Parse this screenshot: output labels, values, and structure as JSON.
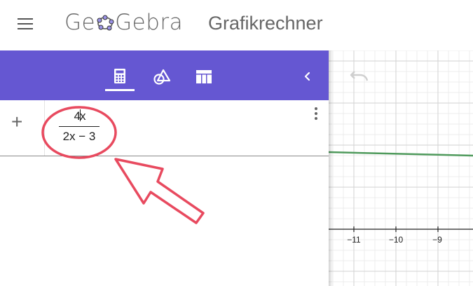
{
  "header": {
    "menu_icon": "hamburger-menu-icon",
    "logo_prefix": "Ge",
    "logo_suffix": "Gebra",
    "app_title": "Grafikrechner"
  },
  "toolbar": {
    "tabs": [
      {
        "icon": "calculator-icon",
        "active": true
      },
      {
        "icon": "geometry-tools-icon",
        "active": false
      },
      {
        "icon": "table-icon",
        "active": false
      }
    ],
    "collapse_icon": "chevron-left-icon",
    "accent_color": "#6557d2"
  },
  "algebra": {
    "add_label": "+",
    "expression": {
      "numerator_before": "4",
      "numerator_after": "x",
      "denominator": "2x − 3"
    },
    "row_menu_icon": "more-vert-icon"
  },
  "graphics": {
    "undo_icon": "undo-icon",
    "x_ticks": [
      "−11",
      "−10",
      "−9"
    ],
    "curve_color": "#4f9a5c",
    "annotation_color": "#e84a5f"
  }
}
